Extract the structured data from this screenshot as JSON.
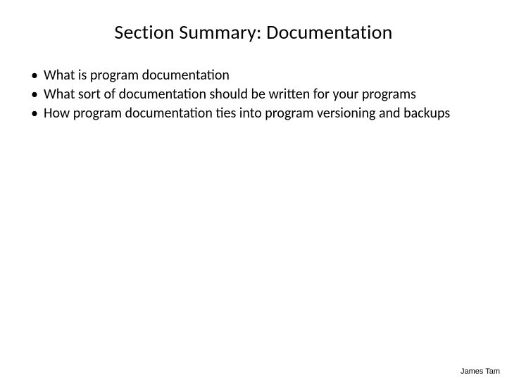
{
  "title": "Section Summary: Documentation",
  "bullets": [
    "What is program documentation",
    "What sort of documentation should be written for your programs",
    "How program documentation ties into program versioning and backups"
  ],
  "footer": "James Tam"
}
